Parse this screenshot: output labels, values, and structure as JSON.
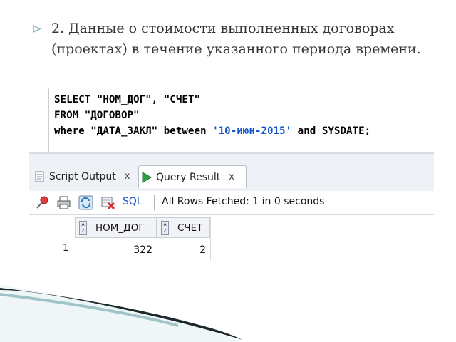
{
  "slide": {
    "bullet_text_line1": "2. Данные о стоимости выполненных договорах",
    "bullet_text_line2": "(проектах) в течение указанного периода времени."
  },
  "editor": {
    "line1": "SELECT \"НОМ_ДОГ\", \"СЧЕТ\"",
    "line2": "FROM \"ДОГОВОР\"",
    "line3_pre": "where \"ДАТА_ЗАКЛ\" between ",
    "line3_str": "'10-июн-2015'",
    "line3_post": " and SYSDATE;"
  },
  "tabs": {
    "script_output": "Script Output",
    "query_result": "Query Result",
    "close_glyph": "x"
  },
  "toolbar": {
    "sql_label": "SQL",
    "status": "All Rows Fetched: 1 in 0 seconds",
    "icons": [
      "pin-icon",
      "print-icon",
      "refresh-icon",
      "cancel-query-icon"
    ]
  },
  "grid": {
    "columns": [
      "НОМ_ДОГ",
      "СЧЕТ"
    ],
    "rows": [
      {
        "num": "1",
        "cells": [
          "322",
          "2"
        ]
      }
    ]
  },
  "colors": {
    "string_literal": "#1155cc",
    "sql_link": "#1a55c8",
    "bullet": "#7fb0b8"
  }
}
